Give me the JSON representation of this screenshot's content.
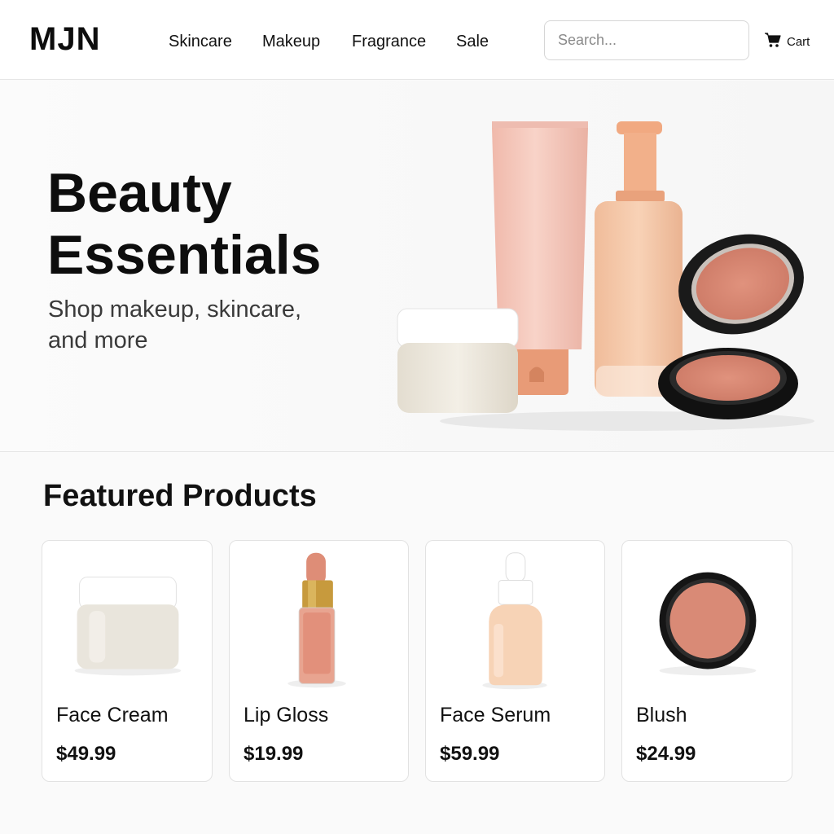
{
  "header": {
    "logo": "MJN",
    "nav": [
      "Skincare",
      "Makeup",
      "Fragrance",
      "Sale"
    ],
    "search_placeholder": "Search...",
    "cart_label": "Cart",
    "cart_icon": "cart-icon"
  },
  "hero": {
    "title": "Beauty Essentials",
    "subtitle": "Shop makeup, skincare, and more"
  },
  "featured": {
    "title": "Featured Products",
    "products": [
      {
        "name": "Face Cream",
        "price": "$49.99"
      },
      {
        "name": "Lip Gloss",
        "price": "$19.99"
      },
      {
        "name": "Face Serum",
        "price": "$59.99"
      },
      {
        "name": "Blush",
        "price": "$24.99"
      }
    ]
  },
  "colors": {
    "text": "#111111",
    "blush": "#d98a76",
    "peach": "#f2c4a8",
    "tube_pink": "#f5c9bd",
    "cream": "#ece6da"
  }
}
